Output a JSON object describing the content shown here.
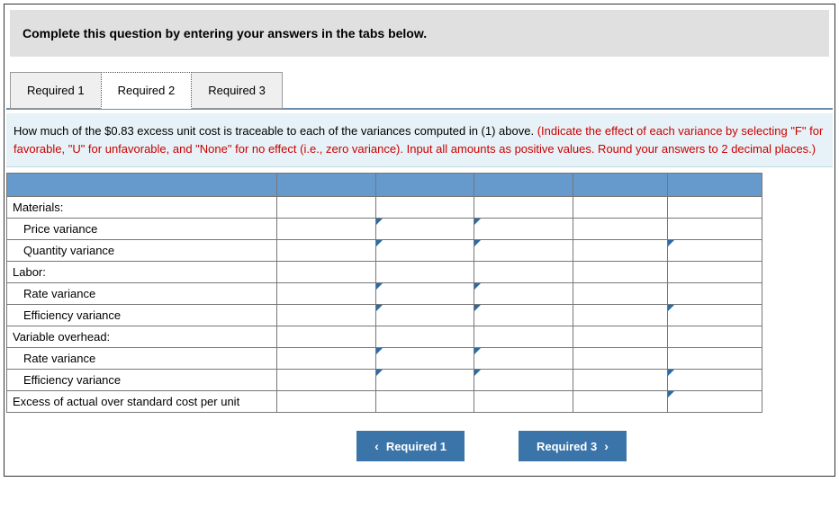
{
  "instruction": "Complete this question by entering your answers in the tabs below.",
  "tabs": {
    "t1": "Required 1",
    "t2": "Required 2",
    "t3": "Required 3"
  },
  "question": {
    "main": "How much of the $0.83 excess unit cost is traceable to each of the variances computed in (1) above. ",
    "note": "(Indicate the effect of each variance by selecting \"F\" for favorable, \"U\" for unfavorable, and \"None\" for no effect (i.e., zero variance). Input all amounts as positive values. Round your answers to 2 decimal places.)"
  },
  "rows": {
    "materials": "Materials:",
    "price_var": "Price variance",
    "qty_var": "Quantity variance",
    "labor": "Labor:",
    "rate_var": "Rate variance",
    "eff_var": "Efficiency variance",
    "var_oh": "Variable overhead:",
    "rate_var2": "Rate variance",
    "eff_var2": "Efficiency variance",
    "excess": "Excess of actual over standard cost per unit"
  },
  "nav": {
    "prev": "Required 1",
    "next": "Required 3"
  }
}
